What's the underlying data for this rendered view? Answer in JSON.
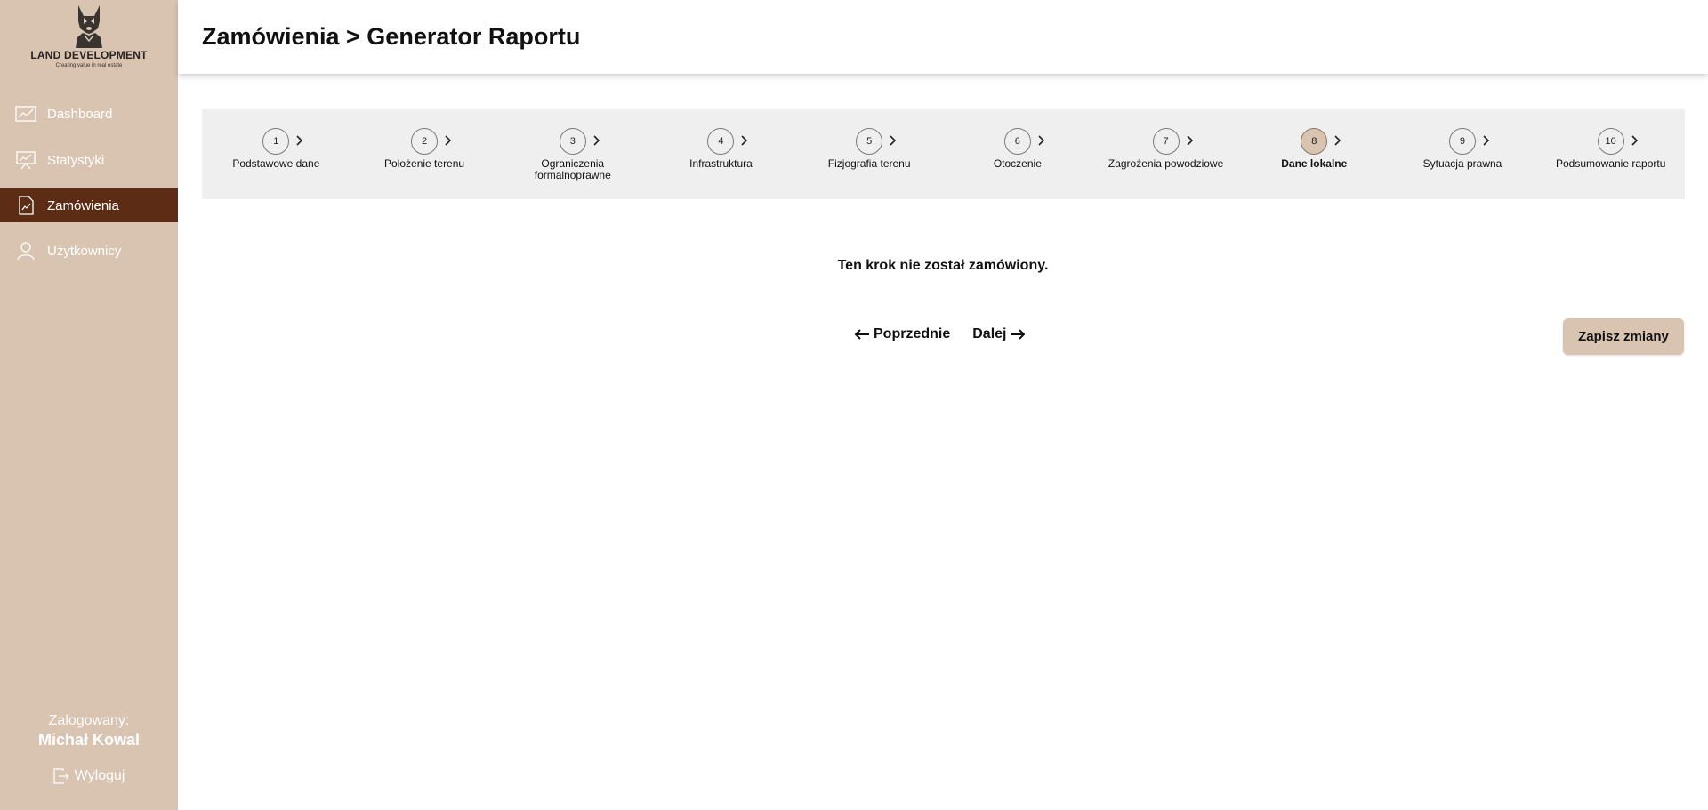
{
  "brand": {
    "name": "LAND DEVELOPMENT",
    "tagline": "Creating value in real estate"
  },
  "sidebar": {
    "items": [
      {
        "label": "Dashboard",
        "icon": "chart-line-icon"
      },
      {
        "label": "Statystyki",
        "icon": "presentation-board-icon"
      },
      {
        "label": "Zamówienia",
        "icon": "document-chart-icon",
        "active": true
      },
      {
        "label": "Użytkownicy",
        "icon": "user-icon"
      }
    ],
    "logged_label": "Zalogowany:",
    "user_name": "Michał Kowal",
    "logout_label": "Wyloguj"
  },
  "header": {
    "title": "Zamówienia > Generator Raportu"
  },
  "stepper": {
    "active_step": 8,
    "steps": [
      {
        "number": "1",
        "label": "Podstawowe dane"
      },
      {
        "number": "2",
        "label": "Położenie terenu"
      },
      {
        "number": "3",
        "label": "Ograniczenia formalnoprawne"
      },
      {
        "number": "4",
        "label": "Infrastruktura"
      },
      {
        "number": "5",
        "label": "Fizjografia terenu"
      },
      {
        "number": "6",
        "label": "Otoczenie"
      },
      {
        "number": "7",
        "label": "Zagrożenia powodziowe"
      },
      {
        "number": "8",
        "label": "Dane lokalne"
      },
      {
        "number": "9",
        "label": "Sytuacja prawna"
      },
      {
        "number": "10",
        "label": "Podsumowanie raportu"
      }
    ]
  },
  "content": {
    "notice": "Ten krok nie został zamówiony.",
    "prev_label": "Poprzednie",
    "next_label": "Dalej",
    "save_label": "Zapisz zmiany"
  },
  "colors": {
    "sidebar_bg": "#d9c4b1",
    "sidebar_active": "#5c2d14",
    "stepper_bg": "#efefef",
    "accent": "#d9c4b1"
  }
}
